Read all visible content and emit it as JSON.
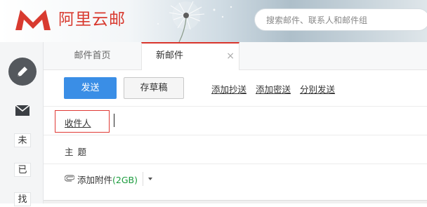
{
  "brand": {
    "name": "阿里云邮",
    "color": "#d83a2f"
  },
  "search": {
    "placeholder": "搜索邮件、联系人和邮件组"
  },
  "sidebar": {
    "compose_icon": "pencil-icon",
    "mail_icon": "envelope-icon",
    "items": [
      {
        "label": "未"
      },
      {
        "label": "已"
      },
      {
        "label": "找"
      }
    ]
  },
  "tabs": [
    {
      "label": "邮件首页",
      "active": false
    },
    {
      "label": "新邮件",
      "active": true,
      "close": "×"
    }
  ],
  "toolbar": {
    "send_label": "发送",
    "draft_label": "存草稿",
    "links": [
      "添加抄送",
      "添加密送",
      "分别发送"
    ]
  },
  "compose": {
    "recipient_label": "收件人",
    "subject_label": "主题",
    "attach_label": "添加附件",
    "attach_size": "(2GB)"
  },
  "colors": {
    "accent": "#3a8ee6",
    "active_tab_border": "#d9352c",
    "highlight": "#e03a35"
  }
}
